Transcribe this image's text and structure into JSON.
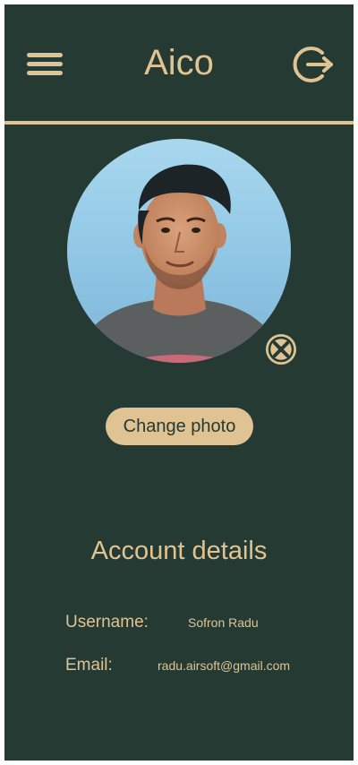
{
  "app": {
    "title": "Aico",
    "colors": {
      "background": "#243a33",
      "accent": "#dfc393",
      "outer": "#ffffff"
    }
  },
  "header": {
    "menu_icon": "hamburger-menu-icon",
    "logout_icon": "logout-icon"
  },
  "profile": {
    "photo_alt": "profile-photo",
    "remove_icon": "close-circle-icon",
    "change_photo_label": "Change photo"
  },
  "account": {
    "section_title": "Account details",
    "username_label": "Username:",
    "username_value": "Sofron Radu",
    "email_label": "Email:",
    "email_value": "radu.airsoft@gmail.com"
  }
}
